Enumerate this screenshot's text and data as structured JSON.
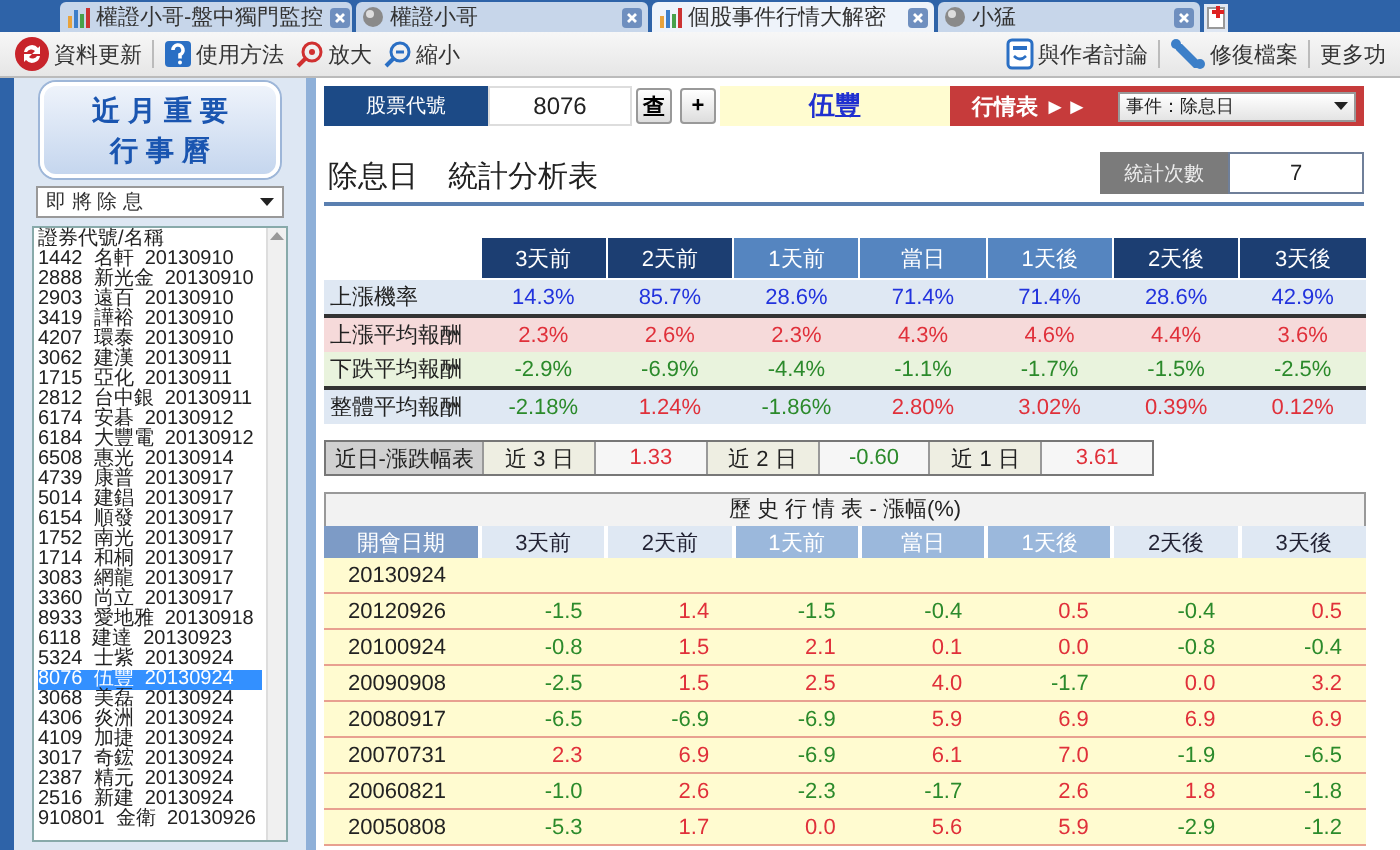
{
  "tabs": [
    {
      "label": "權證小哥-盤中獨門監控",
      "selected": false
    },
    {
      "label": "權證小哥",
      "selected": false
    },
    {
      "label": "個股事件行情大解密",
      "selected": true
    },
    {
      "label": "小猛",
      "selected": false
    }
  ],
  "toolbar": {
    "left": [
      "資料更新",
      "使用方法",
      "放大",
      "縮小"
    ],
    "right": [
      "與作者討論",
      "修復檔案",
      "更多功"
    ]
  },
  "sidebar": {
    "title_lines": [
      "近 月 重 要",
      "行 事 曆"
    ],
    "filter": "即 將 除 息",
    "list_header": "證券代號/名稱",
    "items": [
      {
        "code": "1442",
        "name": "名軒",
        "date": "20130910",
        "selected": false
      },
      {
        "code": "2888",
        "name": "新光金",
        "date": "20130910",
        "selected": false
      },
      {
        "code": "2903",
        "name": "遠百",
        "date": "20130910",
        "selected": false
      },
      {
        "code": "3419",
        "name": "譁裕",
        "date": "20130910",
        "selected": false
      },
      {
        "code": "4207",
        "name": "環泰",
        "date": "20130910",
        "selected": false
      },
      {
        "code": "3062",
        "name": "建漢",
        "date": "20130911",
        "selected": false
      },
      {
        "code": "1715",
        "name": "亞化",
        "date": "20130911",
        "selected": false
      },
      {
        "code": "2812",
        "name": "台中銀",
        "date": "20130911",
        "selected": false
      },
      {
        "code": "6174",
        "name": "安碁",
        "date": "20130912",
        "selected": false
      },
      {
        "code": "6184",
        "name": "大豐電",
        "date": "20130912",
        "selected": false
      },
      {
        "code": "6508",
        "name": "惠光",
        "date": "20130914",
        "selected": false
      },
      {
        "code": "4739",
        "name": "康普",
        "date": "20130917",
        "selected": false
      },
      {
        "code": "5014",
        "name": "建錩",
        "date": "20130917",
        "selected": false
      },
      {
        "code": "6154",
        "name": "順發",
        "date": "20130917",
        "selected": false
      },
      {
        "code": "1752",
        "name": "南光",
        "date": "20130917",
        "selected": false
      },
      {
        "code": "1714",
        "name": "和桐",
        "date": "20130917",
        "selected": false
      },
      {
        "code": "3083",
        "name": "網龍",
        "date": "20130917",
        "selected": false
      },
      {
        "code": "3360",
        "name": "尚立",
        "date": "20130917",
        "selected": false
      },
      {
        "code": "8933",
        "name": "愛地雅",
        "date": "20130918",
        "selected": false
      },
      {
        "code": "6118",
        "name": "建達",
        "date": "20130923",
        "selected": false
      },
      {
        "code": "5324",
        "name": "士紫",
        "date": "20130924",
        "selected": false
      },
      {
        "code": "8076",
        "name": "伍豐",
        "date": "20130924",
        "selected": true
      },
      {
        "code": "3068",
        "name": "美磊",
        "date": "20130924",
        "selected": false
      },
      {
        "code": "4306",
        "name": "炎洲",
        "date": "20130924",
        "selected": false
      },
      {
        "code": "4109",
        "name": "加捷",
        "date": "20130924",
        "selected": false
      },
      {
        "code": "3017",
        "name": "奇鋐",
        "date": "20130924",
        "selected": false
      },
      {
        "code": "2387",
        "name": "精元",
        "date": "20130924",
        "selected": false
      },
      {
        "code": "2516",
        "name": "新建",
        "date": "20130924",
        "selected": false
      },
      {
        "code": "910801",
        "name": "金衛",
        "date": "20130926",
        "selected": false
      }
    ]
  },
  "stock_bar": {
    "code_label": "股票代號",
    "code": "8076",
    "search_button": "查",
    "add_button": "+",
    "stock_name": "伍豐",
    "quote_link": "行情表 ►►",
    "event_select": "事件：除息日"
  },
  "title": "除息日　統計分析表",
  "count_label": "統計次數",
  "count": "7",
  "stats": {
    "columns": [
      {
        "label": "3天前",
        "highlighted": false
      },
      {
        "label": "2天前",
        "highlighted": false
      },
      {
        "label": "1天前",
        "highlighted": true
      },
      {
        "label": "當日",
        "highlighted": true
      },
      {
        "label": "1天後",
        "highlighted": true
      },
      {
        "label": "2天後",
        "highlighted": false
      },
      {
        "label": "3天後",
        "highlighted": false
      }
    ],
    "rows": [
      {
        "kind": "rate",
        "label": "上漲機率",
        "values": [
          "14.3%",
          "85.7%",
          "28.6%",
          "71.4%",
          "71.4%",
          "28.6%",
          "42.9%"
        ]
      },
      {
        "kind": "up",
        "label": "上漲平均報酬",
        "values": [
          "2.3%",
          "2.6%",
          "2.3%",
          "4.3%",
          "4.6%",
          "4.4%",
          "3.6%"
        ]
      },
      {
        "kind": "down",
        "label": "下跌平均報酬",
        "values": [
          "-2.9%",
          "-6.9%",
          "-4.4%",
          "-1.1%",
          "-1.7%",
          "-1.5%",
          "-2.5%"
        ]
      },
      {
        "kind": "overall",
        "label": "整體平均報酬",
        "values": [
          "-2.18%",
          "1.24%",
          "-1.86%",
          "2.80%",
          "3.02%",
          "0.39%",
          "0.12%"
        ]
      }
    ]
  },
  "recent": {
    "label": "近日-漲跌幅表",
    "items": [
      {
        "label": "近 3 日",
        "value": "1.33"
      },
      {
        "label": "近 2 日",
        "value": "-0.60"
      },
      {
        "label": "近 1 日",
        "value": "3.61"
      }
    ]
  },
  "history": {
    "title": "歷 史 行 情 表 - 漲幅(%)",
    "date_column": "開會日期",
    "columns": [
      {
        "label": "3天前",
        "highlighted": false
      },
      {
        "label": "2天前",
        "highlighted": false
      },
      {
        "label": "1天前",
        "highlighted": true
      },
      {
        "label": "當日",
        "highlighted": true
      },
      {
        "label": "1天後",
        "highlighted": true
      },
      {
        "label": "2天後",
        "highlighted": false
      },
      {
        "label": "3天後",
        "highlighted": false
      }
    ],
    "rows": [
      {
        "date": "20130924",
        "values": []
      },
      {
        "date": "20120926",
        "values": [
          "-1.5",
          "1.4",
          "-1.5",
          "-0.4",
          "0.5",
          "-0.4",
          "0.5"
        ]
      },
      {
        "date": "20100924",
        "values": [
          "-0.8",
          "1.5",
          "2.1",
          "0.1",
          "0.0",
          "-0.8",
          "-0.4"
        ]
      },
      {
        "date": "20090908",
        "values": [
          "-2.5",
          "1.5",
          "2.5",
          "4.0",
          "-1.7",
          "0.0",
          "3.2"
        ]
      },
      {
        "date": "20080917",
        "values": [
          "-6.5",
          "-6.9",
          "-6.9",
          "5.9",
          "6.9",
          "6.9",
          "6.9"
        ]
      },
      {
        "date": "20070731",
        "values": [
          "2.3",
          "6.9",
          "-6.9",
          "6.1",
          "7.0",
          "-1.9",
          "-6.5"
        ]
      },
      {
        "date": "20060821",
        "values": [
          "-1.0",
          "2.6",
          "-2.3",
          "-1.7",
          "2.6",
          "1.8",
          "-1.8"
        ]
      },
      {
        "date": "20050808",
        "values": [
          "-5.3",
          "1.7",
          "0.0",
          "5.6",
          "5.9",
          "-2.9",
          "-1.2"
        ]
      }
    ]
  }
}
